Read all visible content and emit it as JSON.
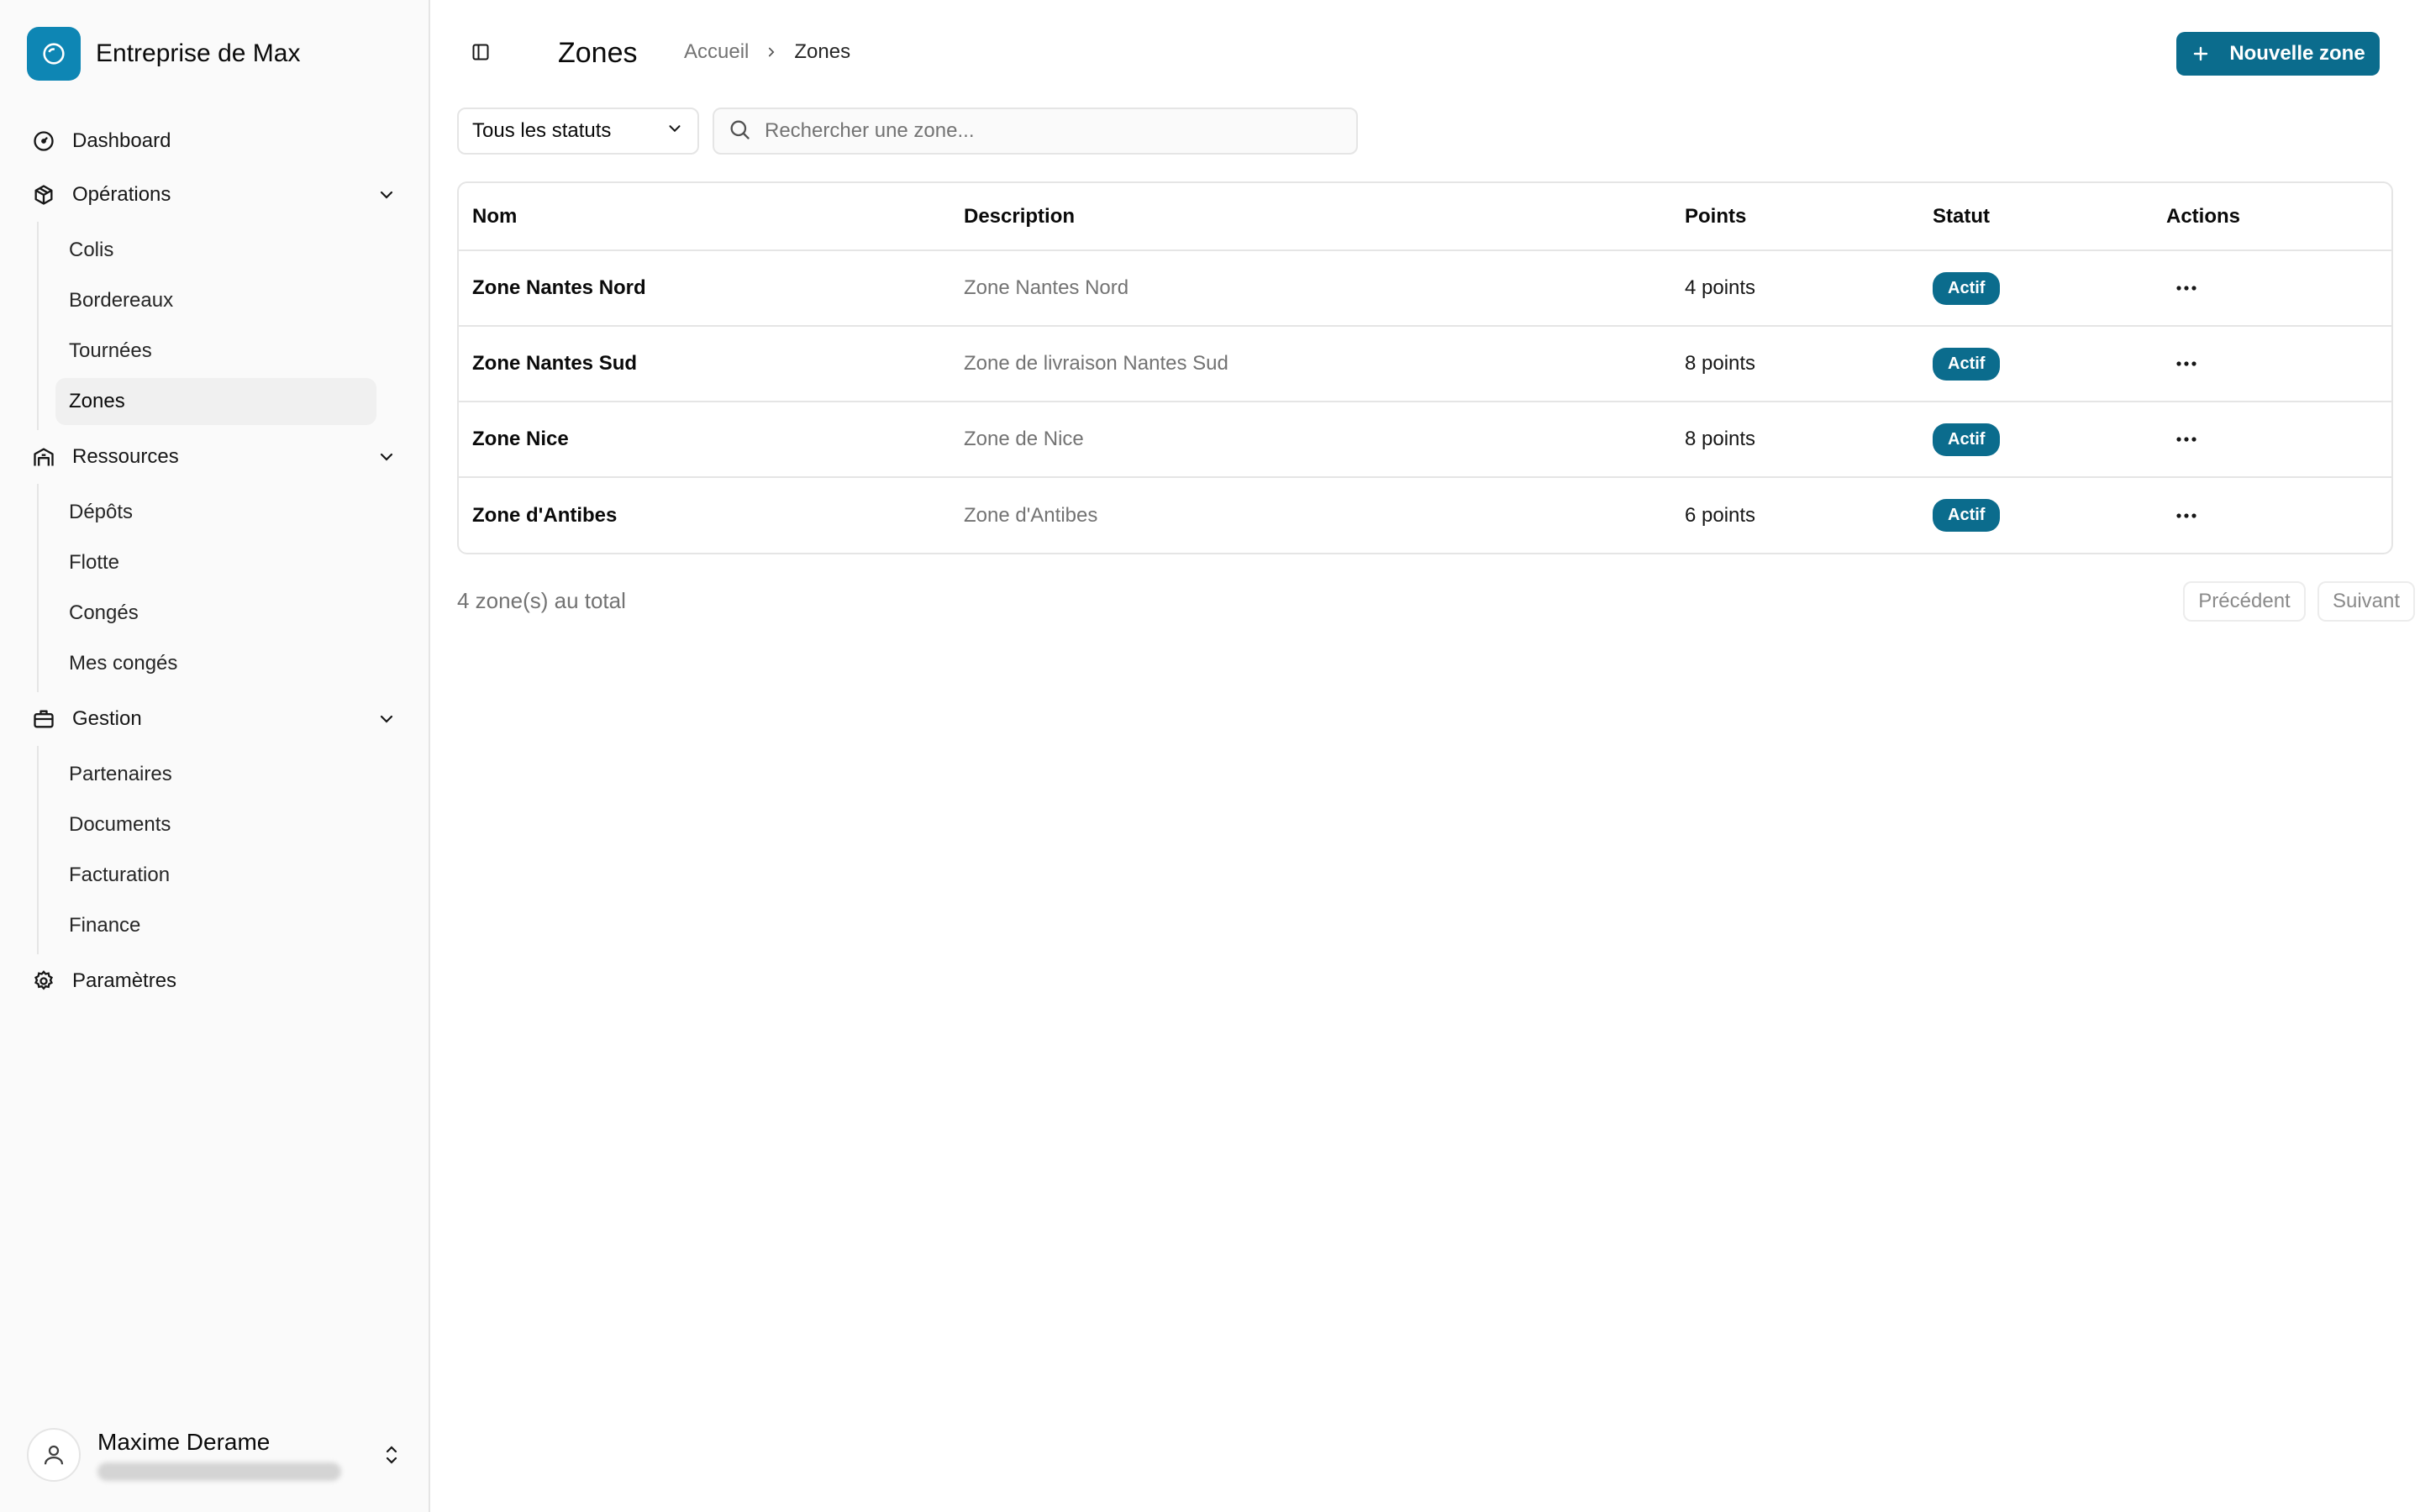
{
  "brand": {
    "name": "Entreprise de Max",
    "logo_icon": "circle-logo-icon",
    "color": "#0e86b4"
  },
  "nav": {
    "dashboard": "Dashboard",
    "operations": {
      "label": "Opérations",
      "items": [
        "Colis",
        "Bordereaux",
        "Tournées",
        "Zones"
      ]
    },
    "ressources": {
      "label": "Ressources",
      "items": [
        "Dépôts",
        "Flotte",
        "Congés",
        "Mes congés"
      ]
    },
    "gestion": {
      "label": "Gestion",
      "items": [
        "Partenaires",
        "Documents",
        "Facturation",
        "Finance"
      ]
    },
    "parametres": "Paramètres",
    "active": "Zones"
  },
  "user": {
    "name": "Maxime Derame"
  },
  "header": {
    "title": "Zones",
    "breadcrumb": {
      "home": "Accueil",
      "current": "Zones"
    },
    "new_button": "Nouvelle zone"
  },
  "filters": {
    "status_selected": "Tous les statuts",
    "search_placeholder": "Rechercher une zone..."
  },
  "table": {
    "headers": {
      "name": "Nom",
      "description": "Description",
      "points": "Points",
      "status": "Statut",
      "actions": "Actions"
    },
    "rows": [
      {
        "name": "Zone Nantes Nord",
        "description": "Zone Nantes Nord",
        "points": "4 points",
        "status": "Actif"
      },
      {
        "name": "Zone Nantes Sud",
        "description": "Zone de livraison Nantes Sud",
        "points": "8 points",
        "status": "Actif"
      },
      {
        "name": "Zone Nice",
        "description": "Zone de Nice",
        "points": "8 points",
        "status": "Actif"
      },
      {
        "name": "Zone d'Antibes",
        "description": "Zone d'Antibes",
        "points": "6 points",
        "status": "Actif"
      }
    ]
  },
  "footer": {
    "total": "4 zone(s) au total",
    "prev": "Précédent",
    "next": "Suivant"
  },
  "colors": {
    "accent": "#0b6c8d",
    "muted_text": "#737373",
    "border": "#e5e5e5"
  }
}
